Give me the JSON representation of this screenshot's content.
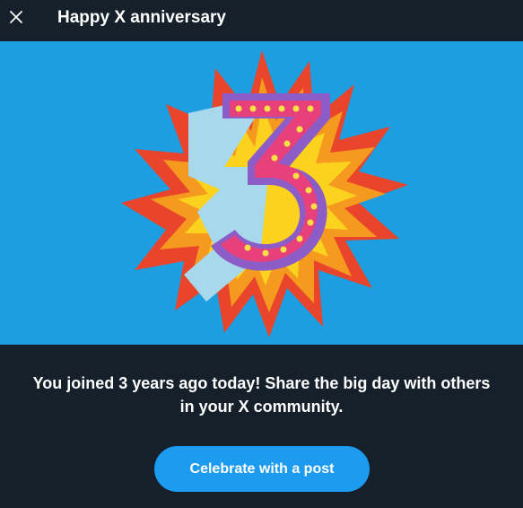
{
  "header": {
    "title": "Happy X anniversary",
    "close_icon": "close-icon"
  },
  "hero": {
    "illustration_number": "3",
    "background_color": "#1d9ee1"
  },
  "message": {
    "text": "You joined 3 years ago today! Share the big day with others in your X community."
  },
  "cta": {
    "label": "Celebrate with a post",
    "color": "#1d9bf0"
  },
  "colors": {
    "background": "#15202b",
    "text": "#ffffff"
  }
}
